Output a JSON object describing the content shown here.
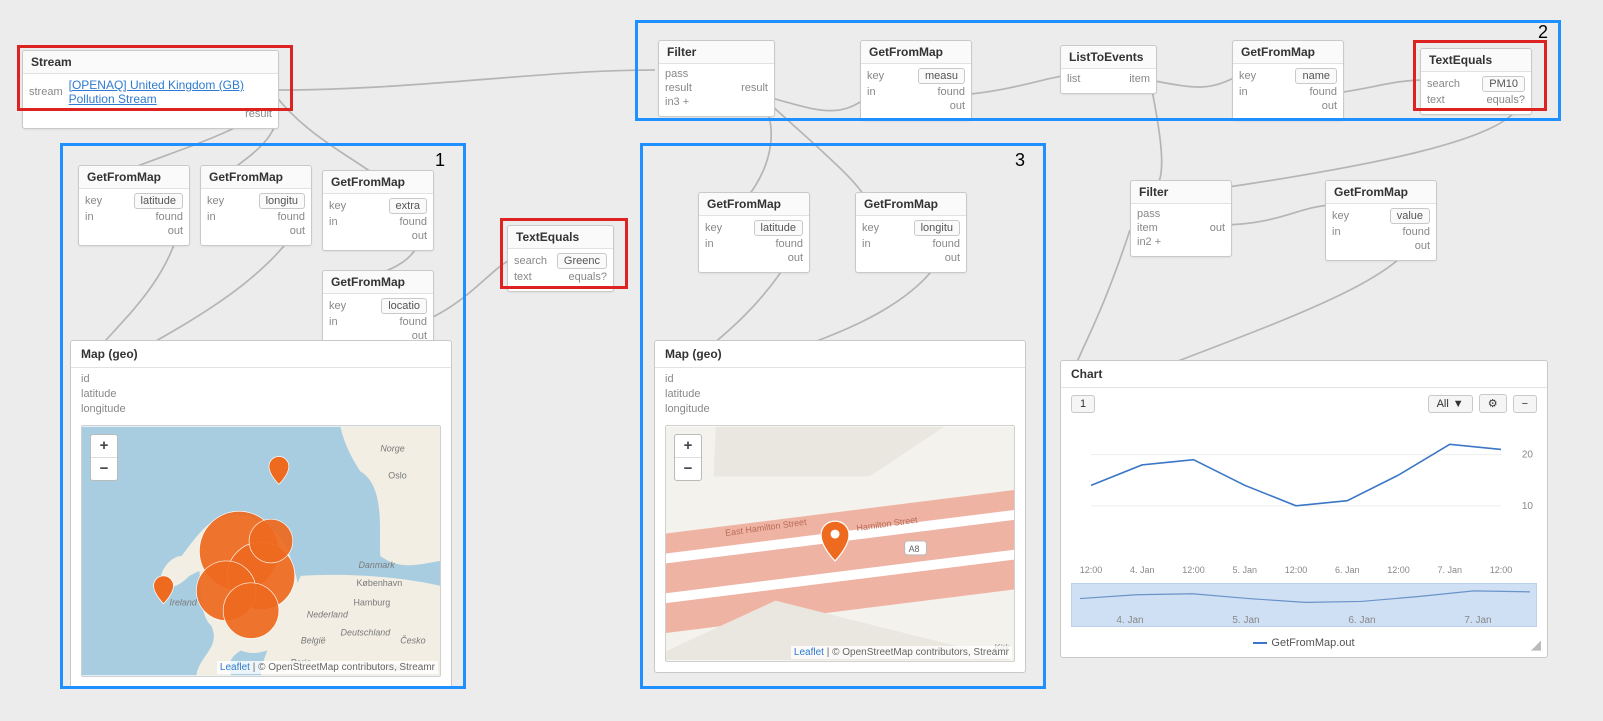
{
  "stream": {
    "title": "Stream",
    "port_label": "stream",
    "link": "[OPENAQ] United Kingdom (GB) Pollution Stream",
    "result_label": "result"
  },
  "group1": {
    "number": "1",
    "getfrommap_title": "GetFromMap",
    "key_label": "key",
    "in_label": "in",
    "found_label": "found",
    "out_label": "out",
    "g1_key": "latitude",
    "g2_key": "longitu",
    "g3_key": "extra",
    "g4_key": "locatio",
    "map_title": "Map (geo)",
    "map_inputs": [
      "id",
      "latitude",
      "longitude"
    ],
    "zoom_in": "+",
    "zoom_out": "−",
    "leaflet": "Leaflet",
    "attrib_tail": " | © OpenStreetMap contributors, Streamr",
    "map_labels": {
      "norge": "Norge",
      "oslo": "Oslo",
      "ireland": "Ireland",
      "danmark": "Danmark",
      "kobenhavn": "København",
      "hamburg": "Hamburg",
      "ned": "Nederland",
      "deutschland": "Deutschland",
      "belgie": "België",
      "paris": "Paris",
      "cesko": "Česko",
      "munchen": "München"
    }
  },
  "textequals1": {
    "title": "TextEquals",
    "search_label": "search",
    "text_label": "text",
    "equals_label": "equals?",
    "value": "Greenc"
  },
  "group2": {
    "number": "2",
    "filter_title": "Filter",
    "filter_labels": {
      "pass": "pass",
      "result_in": "result",
      "result_out": "result",
      "in3": "in3 +"
    },
    "getfrommap_title": "GetFromMap",
    "g1_key": "measu",
    "listtoevents_title": "ListToEvents",
    "list_label": "list",
    "item_label": "item",
    "g2_key": "name",
    "textequals": {
      "title": "TextEquals",
      "search": "search",
      "text": "text",
      "equals": "equals?",
      "value": "PM10"
    }
  },
  "group3": {
    "number": "3",
    "getfrommap_title": "GetFromMap",
    "g1_key": "latitude",
    "g2_key": "longitu",
    "map_title": "Map (geo)",
    "map_inputs": [
      "id",
      "latitude",
      "longitude"
    ],
    "street1": "East Hamilton Street",
    "street2": "Hamilton Street",
    "road": "A8",
    "kirk": "Kirk"
  },
  "lower_right": {
    "filter_title": "Filter",
    "filter_labels": {
      "pass": "pass",
      "item": "item",
      "out": "out",
      "in2": "in2 +"
    },
    "getfrommap_title": "GetFromMap",
    "g_key": "value"
  },
  "chart": {
    "title": "Chart",
    "badge": "1",
    "select": "All",
    "gear": "⚙",
    "minus": "−",
    "legend": "GetFromMap.out",
    "yticks": [
      "20",
      "10"
    ],
    "xticks": [
      "12:00",
      "4. Jan",
      "12:00",
      "5. Jan",
      "12:00",
      "6. Jan",
      "12:00",
      "7. Jan",
      "12:00"
    ],
    "nav_ticks": [
      "4. Jan",
      "5. Jan",
      "6. Jan",
      "7. Jan"
    ]
  },
  "chart_data": {
    "type": "line",
    "ylim": [
      0,
      25
    ],
    "x": [
      "12:00",
      "4. Jan",
      "12:00",
      "5. Jan",
      "12:00",
      "6. Jan",
      "12:00",
      "7. Jan",
      "12:00"
    ],
    "series": [
      {
        "name": "GetFromMap.out",
        "values": [
          14,
          18,
          19,
          14,
          10,
          11,
          16,
          22,
          21
        ]
      }
    ],
    "title": "",
    "xlabel": "",
    "ylabel": ""
  },
  "common": {
    "key": "key",
    "in": "in",
    "found": "found",
    "out": "out"
  }
}
